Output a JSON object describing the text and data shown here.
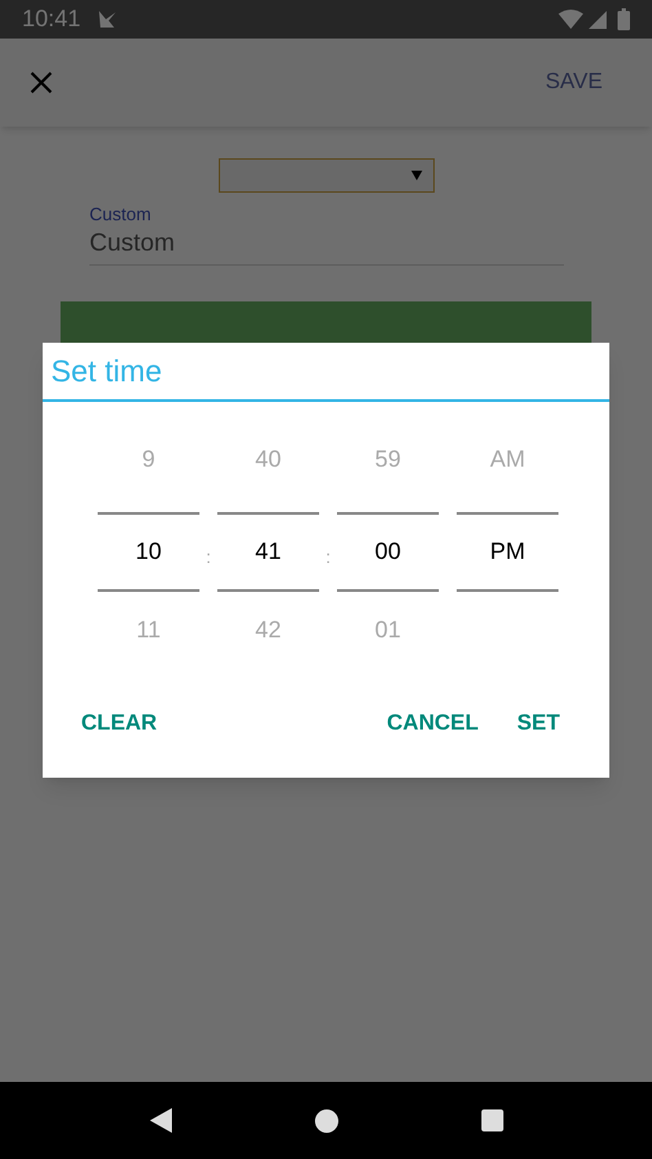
{
  "status_bar": {
    "time": "10:41"
  },
  "app_bar": {
    "action": "SAVE"
  },
  "form": {
    "custom_label": "Custom",
    "custom_value": "Custom"
  },
  "dialog": {
    "title": "Set time",
    "columns": [
      {
        "above": "9",
        "value": "10",
        "below": "11",
        "separator": ":"
      },
      {
        "above": "40",
        "value": "41",
        "below": "42",
        "separator": ":"
      },
      {
        "above": "59",
        "value": "00",
        "below": "01"
      },
      {
        "above": "AM",
        "value": "PM"
      }
    ],
    "buttons": [
      {
        "label": "CLEAR"
      },
      {
        "label": "CANCEL"
      },
      {
        "label": "SET"
      }
    ]
  }
}
